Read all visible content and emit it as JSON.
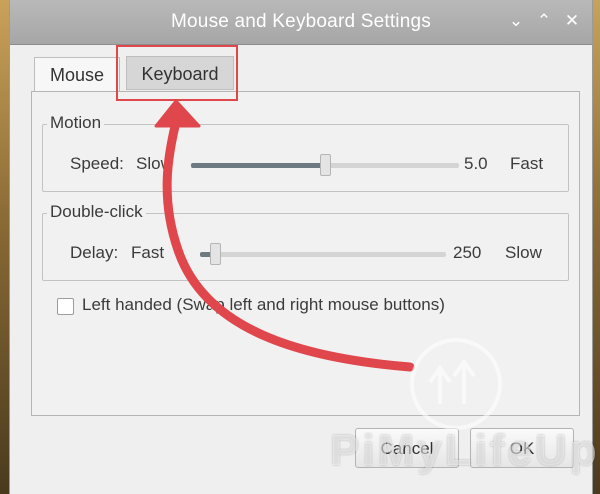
{
  "window": {
    "title": "Mouse and Keyboard Settings",
    "controls": {
      "minimize": "⌄",
      "maximize": "⌃",
      "close": "✕"
    }
  },
  "tabs": [
    {
      "label": "Mouse",
      "selected": false
    },
    {
      "label": "Keyboard",
      "selected": true
    }
  ],
  "motion": {
    "group_label": "Motion",
    "speed_label": "Speed:",
    "slow_label": "Slow",
    "value": "5.0",
    "fast_label": "Fast",
    "level_fraction": 0.5
  },
  "double_click": {
    "group_label": "Double-click",
    "delay_label": "Delay:",
    "fast_label": "Fast",
    "value": "250",
    "slow_label": "Slow",
    "level_fraction": 0.06
  },
  "left_handed": {
    "label": "Left handed (Swap left and right mouse buttons)",
    "checked": false
  },
  "buttons": {
    "cancel": "Cancel",
    "ok": "OK"
  },
  "watermark": {
    "text": "PiMyLifeUp"
  },
  "colors": {
    "highlight": "#e0474c",
    "slider_fill": "#6e7a82"
  },
  "icons": [
    "minimize-icon",
    "maximize-icon",
    "close-icon",
    "checkbox",
    "arrow-annotation",
    "pimylifeup-logo"
  ]
}
